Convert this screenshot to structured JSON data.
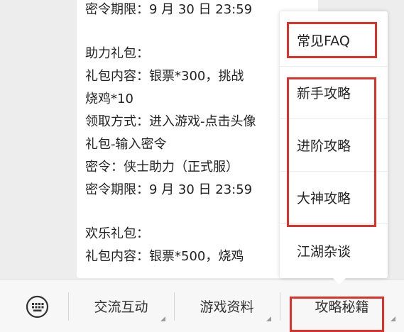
{
  "bubble": {
    "lines": [
      "密令期限：9 月 30 日 23:59",
      "",
      "助力礼包：",
      "礼包内容：银票*300，挑战",
      "烧鸡*10",
      "领取方式：进入游戏-点击头像",
      "礼包-输入密令",
      "密令：侠士助力（正式服）",
      "密令期限：9 月 30 日 23:59",
      "",
      "欢乐礼包：",
      "礼包内容：银票*500，烧鸡"
    ]
  },
  "popup_menu": {
    "items": [
      "常见FAQ",
      "新手攻略",
      "进阶攻略",
      "大神攻略",
      "江湖杂谈"
    ]
  },
  "bottom_bar": {
    "keyboard_icon": "keyboard-icon",
    "items": [
      "交流互动",
      "游戏资料",
      "攻略秘籍"
    ]
  },
  "colors": {
    "background": "#ededed",
    "bubble": "#ffffff",
    "annotation_red": "#e0302a",
    "bar": "#f7f7f7"
  }
}
